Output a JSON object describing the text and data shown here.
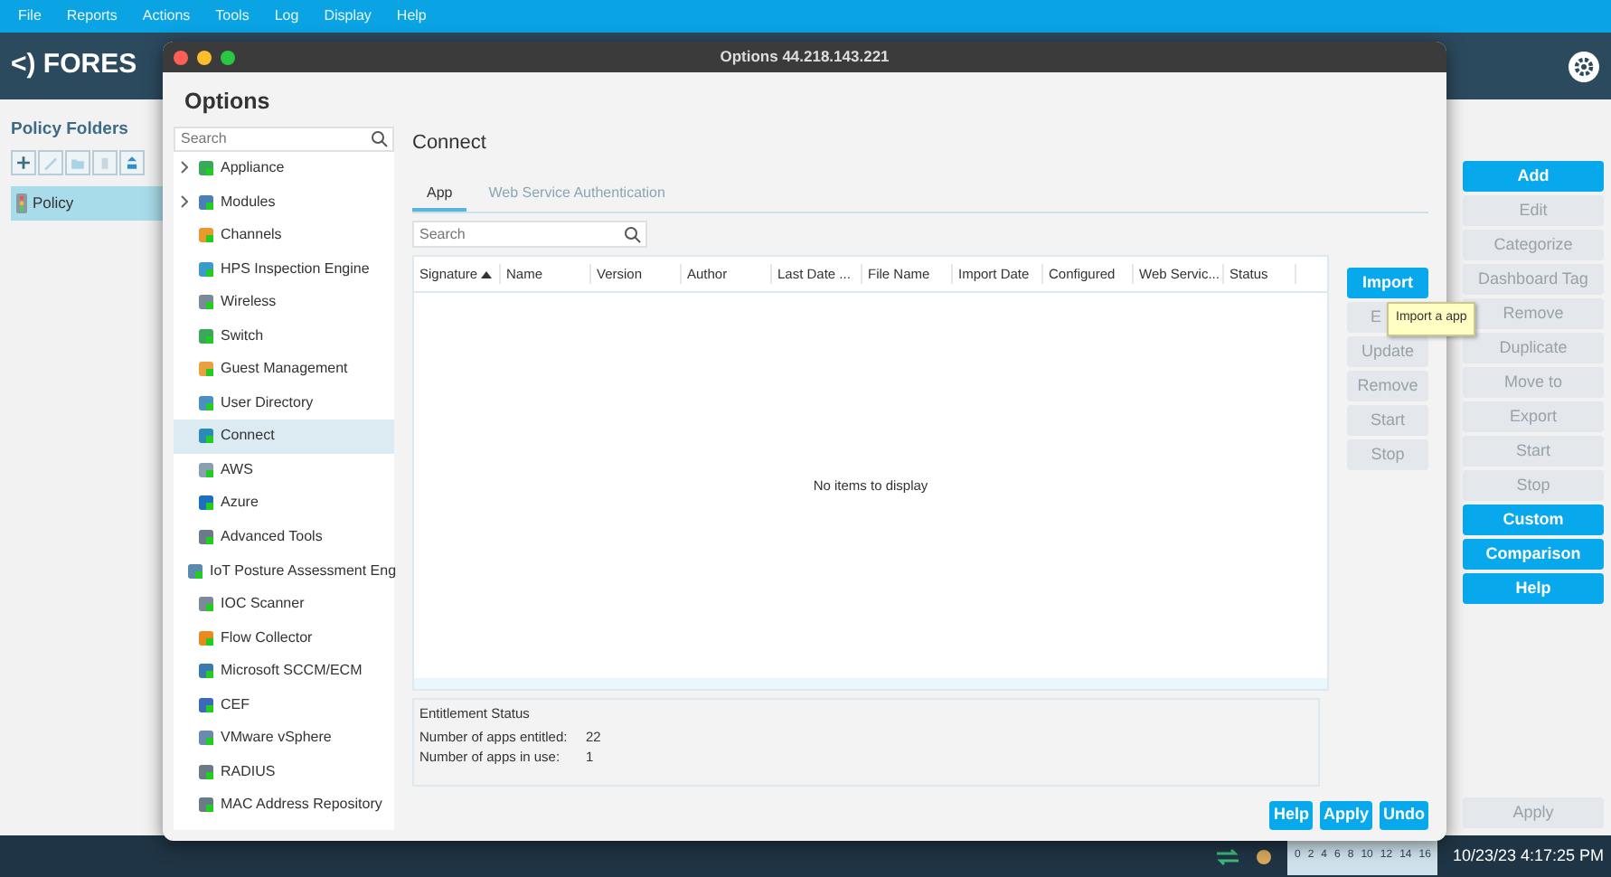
{
  "menu": [
    "File",
    "Reports",
    "Actions",
    "Tools",
    "Log",
    "Display",
    "Help"
  ],
  "logo": "<) FORES",
  "policy_folders": {
    "title": "Policy Folders",
    "items": [
      {
        "label": "Policy",
        "selected": true
      }
    ]
  },
  "side_buttons": [
    {
      "label": "Add",
      "disabled": false
    },
    {
      "label": "Edit",
      "disabled": true
    },
    {
      "label": "Categorize",
      "disabled": true
    },
    {
      "label": "Dashboard Tag",
      "disabled": true
    },
    {
      "label": "Remove",
      "disabled": true
    },
    {
      "label": "Duplicate",
      "disabled": true
    },
    {
      "label": "Move to",
      "disabled": true
    },
    {
      "label": "Export",
      "disabled": true
    },
    {
      "label": "Start",
      "disabled": true
    },
    {
      "label": "Stop",
      "disabled": true
    },
    {
      "label": "Custom",
      "disabled": false
    },
    {
      "label": "Comparison",
      "disabled": false
    },
    {
      "label": "Help",
      "disabled": false
    }
  ],
  "main_apply": {
    "label": "Apply",
    "disabled": true
  },
  "dialog": {
    "window_title": "Options 44.218.143.221",
    "heading": "Options",
    "tree": {
      "placeholder": "Search",
      "items": [
        {
          "label": "Appliance",
          "expandable": true,
          "selected": false
        },
        {
          "label": "Modules",
          "expandable": true,
          "selected": false
        },
        {
          "label": "Channels",
          "expandable": false,
          "selected": false
        },
        {
          "label": "HPS Inspection Engine",
          "expandable": false,
          "selected": false
        },
        {
          "label": "Wireless",
          "expandable": false,
          "selected": false
        },
        {
          "label": "Switch",
          "expandable": false,
          "selected": false
        },
        {
          "label": "Guest Management",
          "expandable": false,
          "selected": false
        },
        {
          "label": "User Directory",
          "expandable": false,
          "selected": false
        },
        {
          "label": "Connect",
          "expandable": false,
          "selected": true
        },
        {
          "label": "AWS",
          "expandable": false,
          "selected": false
        },
        {
          "label": "Azure",
          "expandable": false,
          "selected": false
        },
        {
          "label": "Advanced Tools",
          "expandable": false,
          "selected": false
        },
        {
          "label": "IoT Posture Assessment Eng",
          "expandable": false,
          "selected": false
        },
        {
          "label": "IOC Scanner",
          "expandable": false,
          "selected": false
        },
        {
          "label": "Flow Collector",
          "expandable": false,
          "selected": false
        },
        {
          "label": "Microsoft SCCM/ECM",
          "expandable": false,
          "selected": false
        },
        {
          "label": "CEF",
          "expandable": false,
          "selected": false
        },
        {
          "label": "VMware vSphere",
          "expandable": false,
          "selected": false
        },
        {
          "label": "RADIUS",
          "expandable": false,
          "selected": false
        },
        {
          "label": "MAC Address Repository",
          "expandable": false,
          "selected": false
        }
      ]
    },
    "page_title": "Connect",
    "tabs": [
      {
        "label": "App",
        "selected": true
      },
      {
        "label": "Web Service Authentication",
        "selected": false
      }
    ],
    "search": {
      "placeholder": "Search"
    },
    "table": {
      "columns": [
        {
          "label": "Signature",
          "sorted": true
        },
        {
          "label": "Name",
          "sorted": false
        },
        {
          "label": "Version",
          "sorted": false
        },
        {
          "label": "Author",
          "sorted": false
        },
        {
          "label": "Last Date ...",
          "sorted": false
        },
        {
          "label": "File Name",
          "sorted": false
        },
        {
          "label": "Import Date",
          "sorted": false
        },
        {
          "label": "Configured",
          "sorted": false
        },
        {
          "label": "Web Servic...",
          "sorted": false
        },
        {
          "label": "Status",
          "sorted": false
        }
      ],
      "empty_text": "No items to display"
    },
    "buttons": [
      {
        "label": "Import",
        "disabled": false
      },
      {
        "label": "E",
        "disabled": true
      },
      {
        "label": "Update",
        "disabled": true
      },
      {
        "label": "Remove",
        "disabled": true
      },
      {
        "label": "Start",
        "disabled": true
      },
      {
        "label": "Stop",
        "disabled": true
      }
    ],
    "tooltip": "Import a app",
    "entitlement": {
      "title": "Entitlement Status",
      "rows": [
        {
          "label": "Number of apps entitled:",
          "value": "22"
        },
        {
          "label": "Number of apps in use:",
          "value": "1"
        }
      ]
    },
    "footer_buttons": [
      "Help",
      "Apply",
      "Undo"
    ]
  },
  "taskbar": {
    "scale_labels": [
      "0",
      "2",
      "4",
      "6",
      "8",
      "10",
      "12",
      "14",
      "16"
    ],
    "clock": "10/23/23 4:17:25 PM"
  }
}
